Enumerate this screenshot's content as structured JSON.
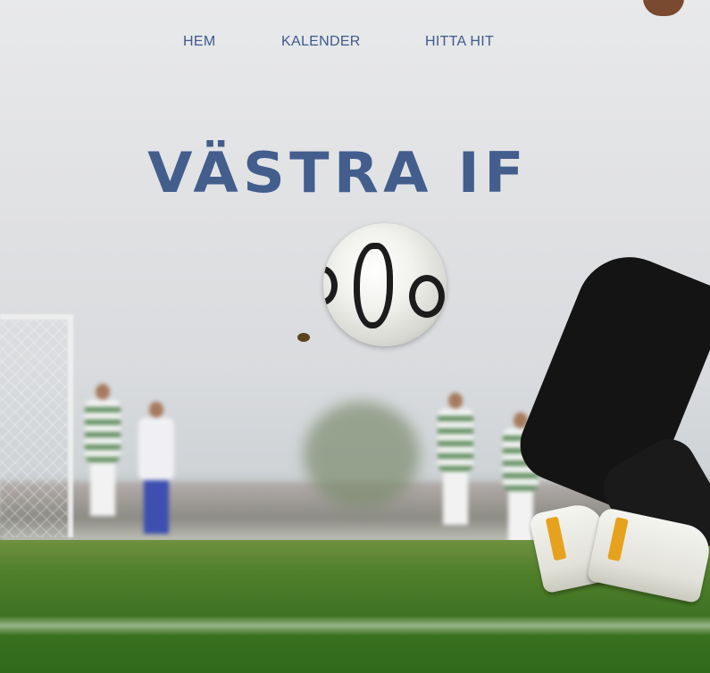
{
  "nav": {
    "items": [
      {
        "label": "HEM"
      },
      {
        "label": "KALENDER"
      },
      {
        "label": "HITTA HIT"
      }
    ]
  },
  "hero": {
    "title": "VÄSTRA IF",
    "background_image": "soccer-kick-photo"
  },
  "colors": {
    "nav_text": "#3e5a8a",
    "title_text": "#435e8d"
  }
}
